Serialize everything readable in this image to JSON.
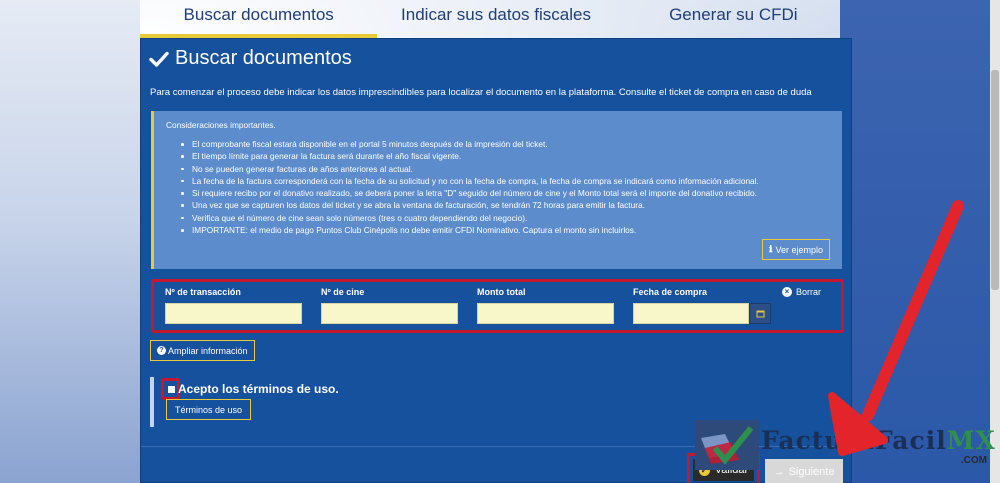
{
  "steps": [
    {
      "label": "Buscar documentos",
      "active": true
    },
    {
      "label": "Indicar sus datos fiscales",
      "active": false
    },
    {
      "label": "Generar su CFDi",
      "active": false
    }
  ],
  "panel": {
    "title": "Buscar documentos",
    "intro": "Para comenzar el proceso debe indicar los datos imprescindibles para localizar el documento en la plataforma. Consulte el ticket de compra en caso de duda",
    "considerations": {
      "heading": "Consideraciones importantes.",
      "items": [
        "El comprobante fiscal estará disponible en el portal 5 minutos después de la impresión del ticket.",
        "El tiempo límite para generar la factura será durante el año fiscal vigente.",
        "No se pueden generar facturas de años anteriores al actual.",
        "La fecha de la factura corresponderá con la fecha de su solicitud y no con la fecha de compra, la fecha de compra se indicará como información adicional.",
        "Si requiere recibo por el donativo realizado, se deberá poner la letra \"D\" seguido del número de cine y el Monto total será el importe del donativo recibido.",
        "Una vez que se capturen los datos del ticket y se abra la ventana de facturación, se tendrán 72 horas para emitir la factura.",
        "Verifica que el número de cine sean solo números (tres o cuatro dependiendo del negocio).",
        "IMPORTANTE: el medio de pago Puntos Club Cinépolis no debe emitir CFDI Nominativo. Captura el monto sin incluirlos."
      ],
      "example_button": "Ver ejemplo"
    },
    "fields": {
      "transaccion": {
        "label": "Nº de transacción",
        "value": ""
      },
      "cine": {
        "label": "Nº de cine",
        "value": ""
      },
      "monto": {
        "label": "Monto total",
        "value": ""
      },
      "fecha": {
        "label": "Fecha de compra",
        "value": ""
      },
      "borrar": "Borrar"
    },
    "ampliar": "Ampliar información",
    "terms": {
      "label": "Acepto los términos de uso.",
      "button": "Términos de uso"
    },
    "footer": {
      "validar": "Validar",
      "siguiente": "Siguiente"
    }
  },
  "watermark": {
    "brand_part1": "Factura",
    "brand_part2": "Facil",
    "brand_part3": "MX",
    "domain": ".COM"
  },
  "colors": {
    "panel": "#16519d",
    "highlight": "#c4182d",
    "accent": "#e8c93a",
    "input": "#f8f7c9"
  }
}
